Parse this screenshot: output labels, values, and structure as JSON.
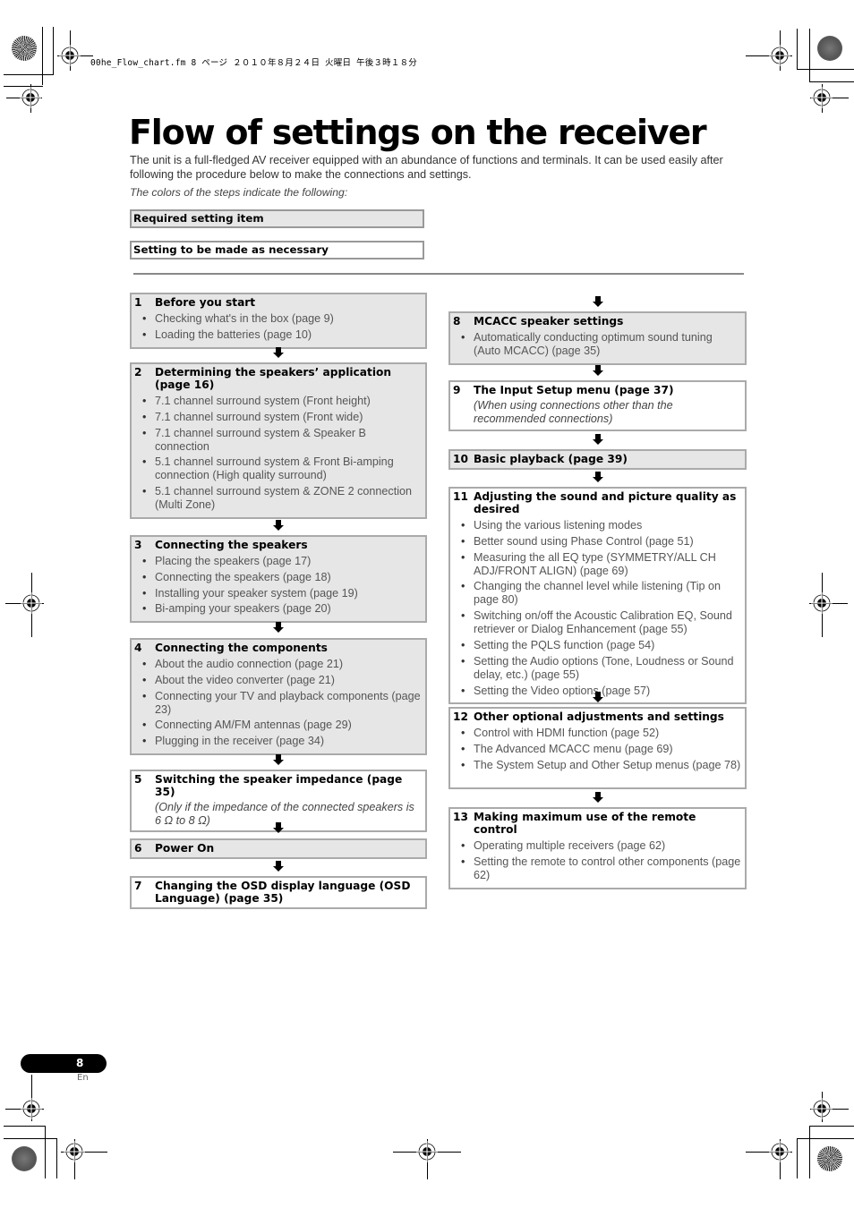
{
  "file_header": "00he_Flow_chart.fm  8 ページ  ２０１０年８月２４日  火曜日  午後３時１８分",
  "title": "Flow of settings on the receiver",
  "intro": "The unit is a full-fledged AV receiver equipped with an abundance of functions and terminals. It can be used easily after following the procedure below to make the connections and settings.",
  "legend": {
    "note": "The colors of the steps indicate the following:",
    "required_label": "Required setting item",
    "optional_label": "Setting to be made as necessary",
    "required_color": "#e6e6e6",
    "optional_color": "#ffffff"
  },
  "steps": [
    {
      "num": "1",
      "title": "Before you start",
      "type": "required",
      "items": [
        "Checking what's in the box (page 9)",
        "Loading the batteries (page 10)"
      ]
    },
    {
      "num": "2",
      "title": "Determining the speakers’ application (page 16)",
      "type": "required",
      "items": [
        "7.1 channel surround system (Front height)",
        "7.1 channel surround system (Front wide)",
        "7.1 channel surround system & Speaker B connection",
        "5.1 channel surround system & Front Bi-amping connection (High quality surround)",
        "5.1 channel surround system & ZONE 2 connection (Multi Zone)"
      ]
    },
    {
      "num": "3",
      "title": "Connecting the speakers",
      "type": "required",
      "items": [
        "Placing the speakers (page 17)",
        "Connecting the speakers (page 18)",
        "Installing your speaker system (page 19)",
        "Bi-amping your speakers (page 20)"
      ]
    },
    {
      "num": "4",
      "title": "Connecting the components",
      "type": "required",
      "items": [
        "About the audio connection (page 21)",
        "About the video converter (page 21)",
        "Connecting your TV and playback components (page 23)",
        "Connecting AM/FM antennas (page 29)",
        "Plugging in the receiver (page 34)"
      ]
    },
    {
      "num": "5",
      "title": "Switching the speaker impedance (page 35)",
      "type": "optional",
      "note": "(Only if the impedance of the connected speakers is 6 Ω to 8 Ω)"
    },
    {
      "num": "6",
      "title": "Power On",
      "type": "required"
    },
    {
      "num": "7",
      "title": "Changing the OSD display language (OSD Language) (page 35)",
      "type": "optional"
    },
    {
      "num": "8",
      "title": "MCACC speaker settings",
      "type": "required",
      "items": [
        "Automatically conducting optimum sound tuning (Auto MCACC) (page 35)"
      ]
    },
    {
      "num": "9",
      "title": "The Input Setup menu (page 37)",
      "type": "optional",
      "note": "(When using connections other than the recommended connections)"
    },
    {
      "num": "10",
      "title": "Basic playback (page 39)",
      "type": "required"
    },
    {
      "num": "11",
      "title": "Adjusting the sound and picture quality as desired",
      "type": "optional",
      "items": [
        "Using the various listening modes",
        "Better sound using Phase Control (page 51)",
        "Measuring the all EQ type (SYMMETRY/ALL CH ADJ/FRONT ALIGN) (page 69)",
        "Changing the channel level while listening (Tip on page 80)",
        "Switching on/off the Acoustic Calibration EQ, Sound retriever or Dialog Enhancement (page 55)",
        "Setting the PQLS function (page 54)",
        "Setting the Audio options (Tone, Loudness or Sound delay, etc.) (page 55)",
        "Setting the Video options (page 57)"
      ]
    },
    {
      "num": "12",
      "title": "Other optional adjustments and settings",
      "type": "optional",
      "items": [
        "Control with HDMI function (page 52)",
        "The Advanced MCACC menu (page 69)",
        "The System Setup and Other Setup menus (page 78)"
      ]
    },
    {
      "num": "13",
      "title": "Making maximum use of the remote control",
      "type": "optional",
      "items": [
        "Operating multiple receivers (page 62)",
        "Setting the remote to control other components (page 62)"
      ]
    }
  ],
  "footer": {
    "page_number": "8",
    "language": "En"
  }
}
